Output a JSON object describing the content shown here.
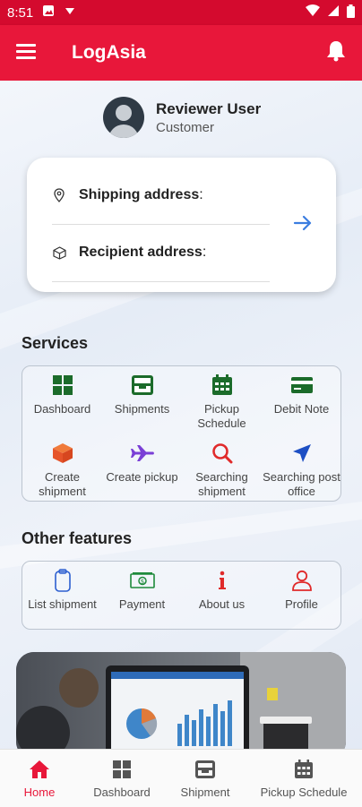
{
  "status_bar": {
    "time": "8:51"
  },
  "app_bar": {
    "title": "LogAsia"
  },
  "user": {
    "name": "Reviewer User",
    "role": "Customer"
  },
  "address_card": {
    "shipping_label": "Shipping address",
    "recipient_label": "Recipient address",
    "colon": ":"
  },
  "services": {
    "title": "Services",
    "items": [
      {
        "label": "Dashboard",
        "icon": "dashboard-icon"
      },
      {
        "label": "Shipments",
        "icon": "inbox-tray-icon"
      },
      {
        "label": "Pickup Schedule",
        "icon": "calendar-icon"
      },
      {
        "label": "Debit Note",
        "icon": "credit-card-icon"
      },
      {
        "label": "Create shipment",
        "icon": "box-icon"
      },
      {
        "label": "Create pickup",
        "icon": "airplane-icon"
      },
      {
        "label": "Searching shipment",
        "icon": "search-icon"
      },
      {
        "label": "Searching post office",
        "icon": "navigation-arrow-icon"
      }
    ]
  },
  "other_features": {
    "title": "Other features",
    "items": [
      {
        "label": "List shipment",
        "icon": "clipboard-icon"
      },
      {
        "label": "Payment",
        "icon": "cash-icon"
      },
      {
        "label": "About us",
        "icon": "info-icon"
      },
      {
        "label": "Profile",
        "icon": "person-icon"
      }
    ]
  },
  "bottom_nav": [
    {
      "label": "Home",
      "icon": "home-icon",
      "active": true
    },
    {
      "label": "Dashboard",
      "icon": "dashboard-icon",
      "active": false
    },
    {
      "label": "Shipment",
      "icon": "inbox-tray-icon",
      "active": false
    },
    {
      "label": "Pickup Schedule",
      "icon": "calendar-icon",
      "active": false
    }
  ],
  "colors": {
    "brand": "#e8173a",
    "status_bar": "#d40a2e",
    "service_green": "#1b6b2a",
    "accent_blue": "#3b7de0"
  }
}
